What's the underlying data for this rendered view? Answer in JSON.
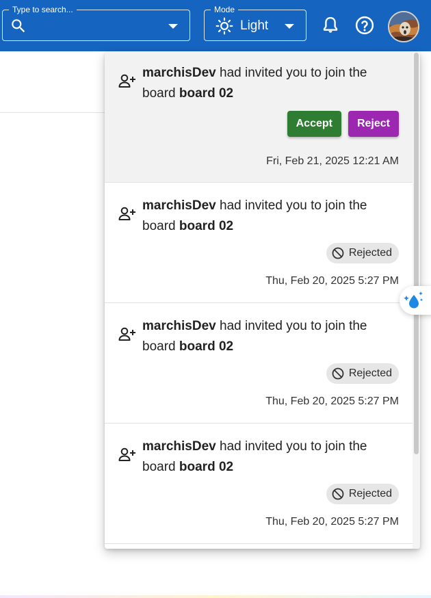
{
  "header": {
    "search": {
      "label": "Type to search...",
      "value": ""
    },
    "mode": {
      "label": "Mode",
      "value": "Light"
    },
    "icons": [
      "search-icon",
      "sun-icon",
      "bell-icon",
      "help-icon",
      "avatar"
    ],
    "colors": {
      "appbar": "#1565c0"
    }
  },
  "notifications": [
    {
      "user": "marchisDev",
      "message": "had invited you to join the board",
      "board": "board 02",
      "status": "pending",
      "accept_label": "Accept",
      "reject_label": "Reject",
      "timestamp": "Fri, Feb 21, 2025 12:21 AM"
    },
    {
      "user": "marchisDev",
      "message": "had invited you to join the board",
      "board": "board 02",
      "status": "rejected",
      "status_label": "Rejected",
      "timestamp": "Thu, Feb 20, 2025 5:27 PM"
    },
    {
      "user": "marchisDev",
      "message": "had invited you to join the board",
      "board": "board 02",
      "status": "rejected",
      "status_label": "Rejected",
      "timestamp": "Thu, Feb 20, 2025 5:27 PM"
    },
    {
      "user": "marchisDev",
      "message": "had invited you to join the board",
      "board": "board 02",
      "status": "rejected",
      "status_label": "Rejected",
      "timestamp": "Thu, Feb 20, 2025 5:27 PM"
    }
  ],
  "colors": {
    "accept": "#2e7d32",
    "reject": "#9c27b0",
    "chip": "#e6e6e6",
    "unread": "#f2f2f2"
  }
}
